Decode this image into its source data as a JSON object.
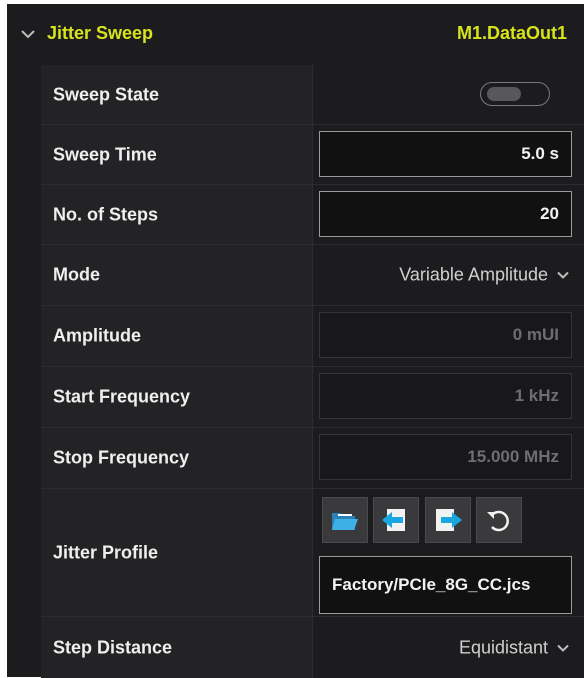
{
  "header": {
    "title": "Jitter Sweep",
    "target": "M1.DataOut1"
  },
  "rows": {
    "sweep_state": {
      "label": "Sweep State",
      "enabled": false
    },
    "sweep_time": {
      "label": "Sweep Time",
      "value": "5.0 s"
    },
    "steps": {
      "label": "No. of Steps",
      "value": "20"
    },
    "mode": {
      "label": "Mode",
      "value": "Variable Amplitude"
    },
    "amplitude": {
      "label": "Amplitude",
      "value": "0 mUI"
    },
    "start_freq": {
      "label": "Start Frequency",
      "value": "1 kHz"
    },
    "stop_freq": {
      "label": "Stop Frequency",
      "value": "15.000 MHz"
    },
    "jitter_profile": {
      "label": "Jitter Profile",
      "value": "Factory/PCIe_8G_CC.jcs",
      "buttons": [
        "open-folder-icon",
        "import-icon",
        "export-icon",
        "reset-icon"
      ]
    },
    "step_distance": {
      "label": "Step Distance",
      "value": "Equidistant"
    }
  },
  "colors": {
    "accent": "#d7e31b",
    "background": "#1c1c1e",
    "label_bg": "#232325",
    "icon_blue": "#1aa7e0"
  }
}
